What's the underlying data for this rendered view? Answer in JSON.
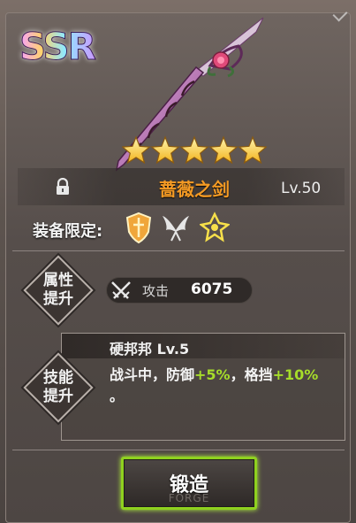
{
  "rarity": "SSR",
  "item": {
    "name": "蔷薇之剑",
    "level_label": "Lv.50",
    "stars": 5,
    "locked": true
  },
  "equip": {
    "label": "装备限定:",
    "classes": [
      "shield-class-icon",
      "wings-class-icon",
      "emblem-class-icon"
    ]
  },
  "attribute": {
    "section_label_line1": "属性",
    "section_label_line2": "提升",
    "stat_name": "攻击",
    "stat_value": "6075"
  },
  "skill": {
    "section_label_line1": "技能",
    "section_label_line2": "提升",
    "title": "硬邦邦 Lv.5",
    "desc_part1": "战斗中，防御",
    "desc_bonus1": "+5%",
    "desc_part2": "，格挡",
    "desc_bonus2": "+10%",
    "desc_part3": "。"
  },
  "forge_button": {
    "label": "锻造",
    "sublabel": "FORGE"
  },
  "colors": {
    "name": "#f49a24",
    "bonus": "#a6dd2a",
    "button_border": "#8fd11f"
  }
}
